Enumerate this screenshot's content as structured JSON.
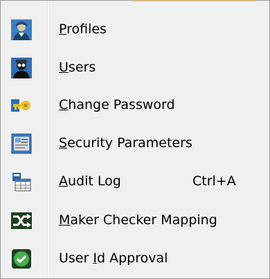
{
  "menu": {
    "items": [
      {
        "pre": "",
        "accel": "P",
        "post": "rofiles",
        "shortcut": "",
        "icon": "profile-icon"
      },
      {
        "pre": "",
        "accel": "U",
        "post": "sers",
        "shortcut": "",
        "icon": "users-icon"
      },
      {
        "pre": "",
        "accel": "C",
        "post": "hange Password",
        "shortcut": "",
        "icon": "key-icon"
      },
      {
        "pre": "",
        "accel": "S",
        "post": "ecurity Parameters",
        "shortcut": "",
        "icon": "security-params-icon"
      },
      {
        "pre": "",
        "accel": "A",
        "post": "udit Log",
        "shortcut": "Ctrl+A",
        "icon": "audit-log-icon"
      },
      {
        "pre": "",
        "accel": "M",
        "post": "aker Checker Mapping",
        "shortcut": "",
        "icon": "shuffle-icon"
      },
      {
        "pre": "User ",
        "accel": "I",
        "post": "d Approval",
        "shortcut": "",
        "icon": "approval-check-icon"
      }
    ]
  },
  "colors": {
    "menu_background": "#f0f0f0",
    "border": "#979797",
    "approval_green": "#2e8b3a"
  }
}
